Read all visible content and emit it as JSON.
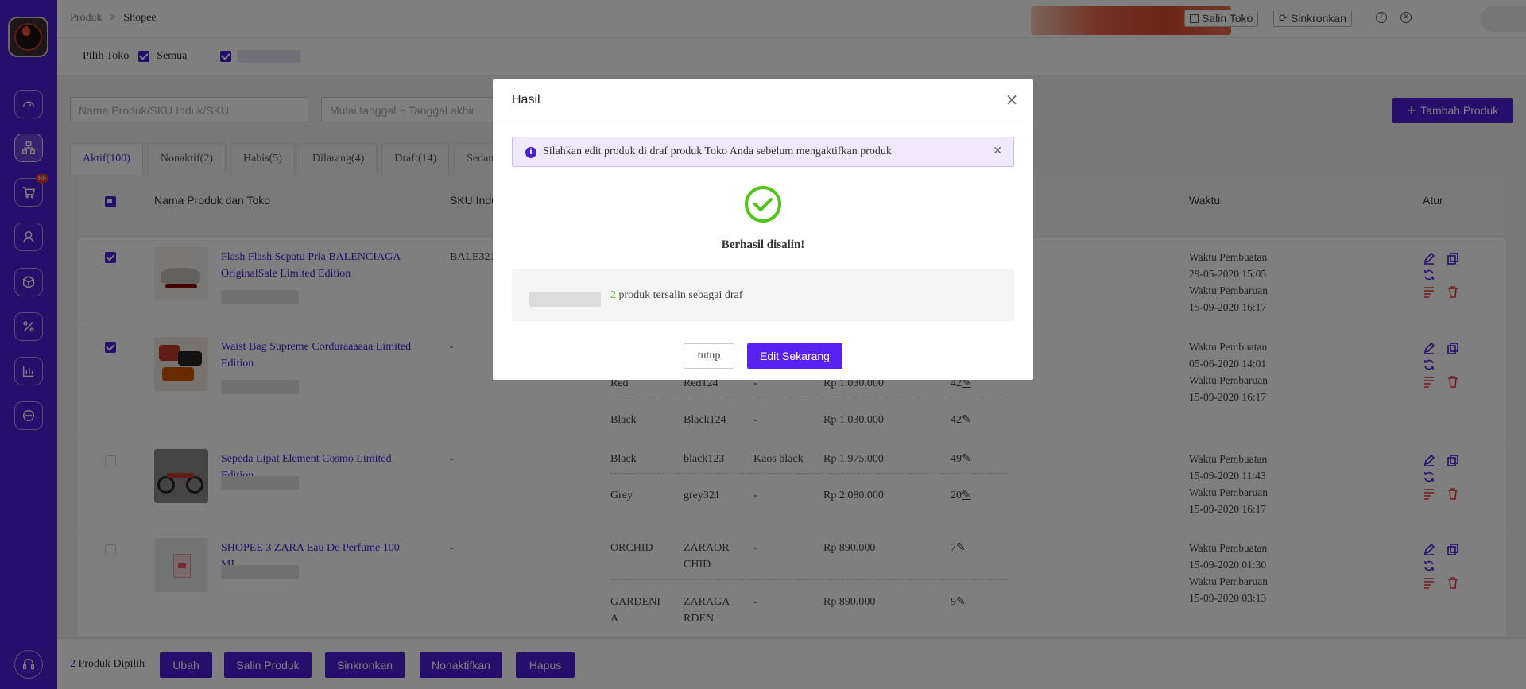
{
  "breadcrumb": {
    "root": "Produk",
    "separator": ">",
    "current": "Shopee"
  },
  "header": {
    "copy_store_label": "Salin Toko",
    "sync_label": "Sinkronkan"
  },
  "store_select": {
    "label": "Pilih Toko",
    "all_label": "Semua"
  },
  "filters": {
    "search_placeholder": "Nama Produk/SKU Induk/SKU",
    "date_placeholder": "Mulai tanggal ~ Tanggal akhir",
    "add_product_label": "Tambah Produk"
  },
  "tabs": [
    {
      "label": "Aktif(100)"
    },
    {
      "label": "Nonaktif(2)"
    },
    {
      "label": "Habis(5)"
    },
    {
      "label": "Dilarang(4)"
    },
    {
      "label": "Draft(14)"
    },
    {
      "label": "Sedang"
    }
  ],
  "table": {
    "headers": {
      "name": "Nama Produk dan Toko",
      "sku": "SKU Indu",
      "time": "Waktu",
      "actions": "Atur"
    },
    "rows": [
      {
        "name": "Flash Flash Sepatu Pria BALENCIAGA OriginalSale Limited Edition",
        "sku": "BALE321",
        "variants": [],
        "created_label": "Waktu Pembuatan",
        "created": "29-05-2020 15:05",
        "updated_label": "Waktu Pembaruan",
        "updated": "15-09-2020 16:17"
      },
      {
        "name": "Waist Bag Supreme Corduraaaaaa Limited Edition",
        "sku": "-",
        "variants": [
          {
            "color": "Red",
            "sku": "Red124",
            "desc": "-",
            "price": "Rp 1.030.000",
            "stock": "42"
          },
          {
            "color": "Black",
            "sku": "Black124",
            "desc": "-",
            "price": "Rp 1.030.000",
            "stock": "42"
          }
        ],
        "created_label": "Waktu Pembuatan",
        "created": "05-06-2020 14:01",
        "updated_label": "Waktu Pembaruan",
        "updated": "15-09-2020 16:17"
      },
      {
        "name": "Sepeda Lipat Element Cosmo Limited Edition",
        "sku": "-",
        "variants": [
          {
            "color": "Black",
            "sku": "black123",
            "desc": "Kaos black",
            "price": "Rp 1.975.000",
            "stock": "49"
          },
          {
            "color": "Grey",
            "sku": "grey321",
            "desc": "-",
            "price": "Rp 2.080.000",
            "stock": "20"
          }
        ],
        "created_label": "Waktu Pembuatan",
        "created": "15-09-2020 11:43",
        "updated_label": "Waktu Pembaruan",
        "updated": "15-09-2020 16:17"
      },
      {
        "name": "SHOPEE 3 ZARA Eau De Perfume 100 ML",
        "sku": "-",
        "variants": [
          {
            "color": "ORCHID",
            "sku_l1": "ZARAOR",
            "sku_l2": "CHID",
            "desc": "-",
            "price": "Rp 890.000",
            "stock": "7"
          },
          {
            "color_l1": "GARDENI",
            "color_l2": "A",
            "sku_l1": "ZARAGA",
            "sku_l2": "RDEN",
            "desc": "-",
            "price": "Rp 890.000",
            "stock": "9"
          }
        ],
        "created_label": "Waktu Pembuatan",
        "created": "15-09-2020 01:30",
        "updated_label": "Waktu Pembaruan",
        "updated": "15-09-2020 03:13"
      }
    ]
  },
  "bottom_bar": {
    "selected_count": "2",
    "selected_label": "Produk Dipilih",
    "buttons": [
      "Ubah",
      "Salin Produk",
      "Sinkronkan",
      "Nonaktifkan",
      "Hapus"
    ]
  },
  "sidebar": {
    "cart_badge": "68"
  },
  "modal": {
    "title": "Hasil",
    "alert_text": "Silahkan edit produk di draf produk Toko Anda sebelum mengaktifkan produk",
    "success_text": "Berhasil disalin!",
    "result_count": "2",
    "result_text": "produk tersalin sebagai draf",
    "close_label": "tutup",
    "edit_label": "Edit Sekarang"
  },
  "colors": {
    "brand": "#4b1fd6",
    "success": "#52c41a",
    "danger": "#e53935"
  }
}
